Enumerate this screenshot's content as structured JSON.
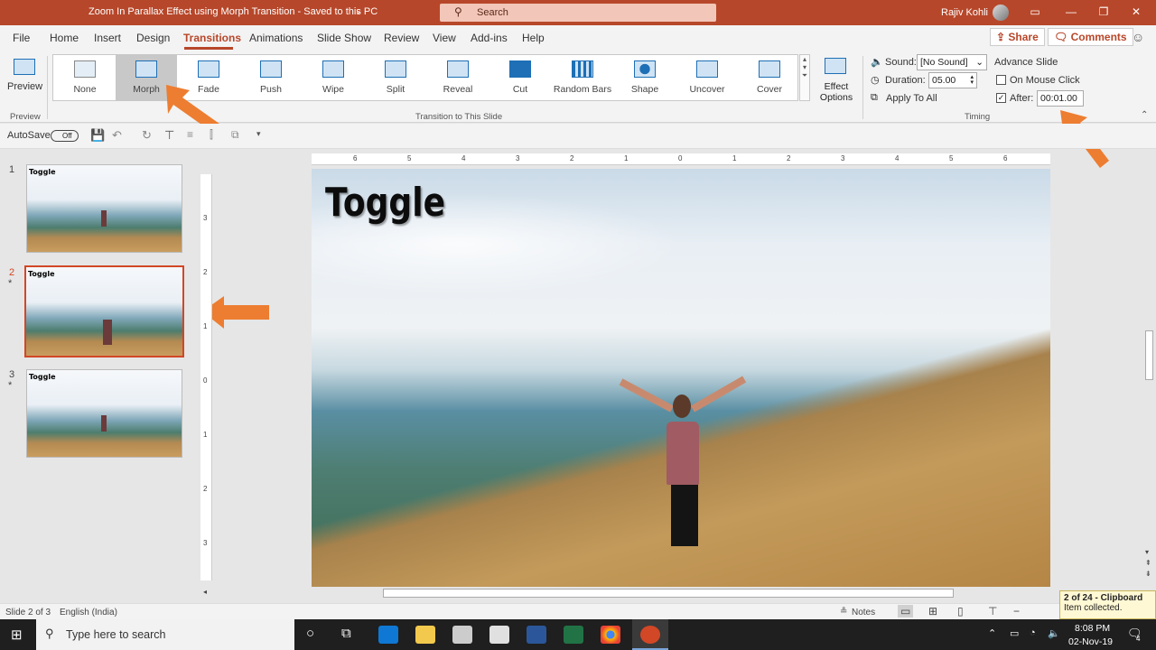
{
  "titlebar": {
    "doc_title": "Zoom In Parallax Effect using Morph Transition  -  Saved to this PC",
    "search_placeholder": "Search",
    "user_name": "Rajiv Kohli"
  },
  "menu": {
    "tabs": [
      "File",
      "Home",
      "Insert",
      "Design",
      "Transitions",
      "Animations",
      "Slide Show",
      "Review",
      "View",
      "Add-ins",
      "Help"
    ],
    "active_tab": "Transitions",
    "share_label": "Share",
    "comments_label": "Comments"
  },
  "ribbon": {
    "preview_label": "Preview",
    "preview_group": "Preview",
    "transitions": [
      "None",
      "Morph",
      "Fade",
      "Push",
      "Wipe",
      "Split",
      "Reveal",
      "Cut",
      "Random Bars",
      "Shape",
      "Uncover",
      "Cover"
    ],
    "selected_transition": "Morph",
    "effect_options_label": "Effect Options",
    "transition_group": "Transition to This Slide",
    "sound_label": "Sound:",
    "sound_value": "[No Sound]",
    "duration_label": "Duration:",
    "duration_value": "05.00",
    "apply_all_label": "Apply To All",
    "advance_slide_label": "Advance Slide",
    "on_mouse_click_label": "On Mouse Click",
    "on_mouse_click_checked": false,
    "after_label": "After:",
    "after_checked": true,
    "after_value": "00:01.00",
    "timing_group": "Timing"
  },
  "qat": {
    "autosave_label": "AutoSave",
    "autosave_state": "Off"
  },
  "slides": [
    {
      "number": "1",
      "title": "Toggle",
      "star": ""
    },
    {
      "number": "2",
      "title": "Toggle",
      "star": "*"
    },
    {
      "number": "3",
      "title": "Toggle",
      "star": "*"
    }
  ],
  "selected_slide": 2,
  "slide": {
    "title": "Toggle"
  },
  "statusbar": {
    "slide_info": "Slide 2 of 3",
    "language": "English (India)",
    "notes_label": "Notes"
  },
  "clipboard": {
    "title": "2 of 24 - Clipboard",
    "subtitle": "Item collected."
  },
  "taskbar": {
    "search_placeholder": "Type here to search",
    "time": "8:08 PM",
    "date": "02-Nov-19",
    "notification_count": "4"
  },
  "colors": {
    "brand": "#b7472a",
    "accent_arrow": "#ed7d31",
    "selection_border": "#d24726"
  },
  "ruler": {
    "h_ticks": [
      "6",
      "5",
      "4",
      "3",
      "2",
      "1",
      "0",
      "1",
      "2",
      "3",
      "4",
      "5",
      "6"
    ],
    "v_ticks": [
      "3",
      "2",
      "1",
      "0",
      "1",
      "2",
      "3"
    ]
  }
}
